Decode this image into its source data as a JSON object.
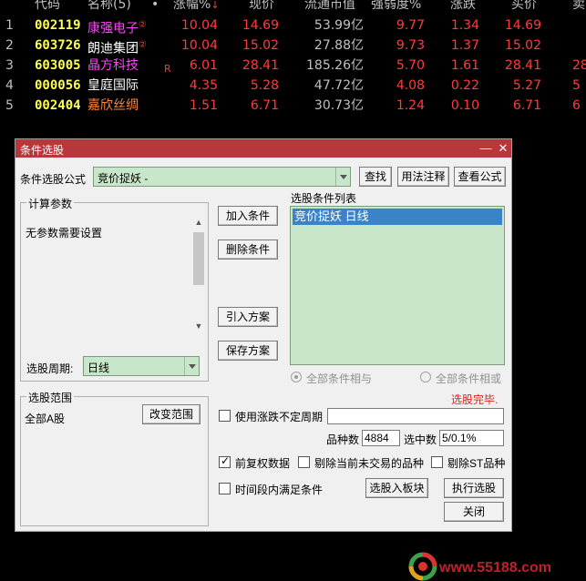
{
  "table": {
    "headers": [
      "代码",
      "名称(5)",
      "•",
      "涨幅%",
      "现价",
      "流通市值",
      "强弱度%",
      "涨跌",
      "买价",
      "卖"
    ],
    "rows": [
      {
        "idx": "1",
        "code": "002119",
        "name": "康强电子",
        "mark": "②",
        "name_color": "#ff44ff",
        "flag": "",
        "chg_pct": "10.04",
        "price": "14.69",
        "mcap": "53.99亿",
        "strength": "9.77",
        "chg": "1.34",
        "bid": "14.69",
        "ask": ""
      },
      {
        "idx": "2",
        "code": "603726",
        "name": "朗迪集团",
        "mark": "②",
        "name_color": "#ffffff",
        "flag": "",
        "chg_pct": "10.04",
        "price": "15.02",
        "mcap": "27.88亿",
        "strength": "9.73",
        "chg": "1.37",
        "bid": "15.02",
        "ask": ""
      },
      {
        "idx": "3",
        "code": "603005",
        "name": "晶方科技",
        "mark": "",
        "name_color": "#ff44ff",
        "flag": "R",
        "chg_pct": "6.01",
        "price": "28.41",
        "mcap": "185.26亿",
        "strength": "5.70",
        "chg": "1.61",
        "bid": "28.41",
        "ask": "28"
      },
      {
        "idx": "4",
        "code": "000056",
        "name": "皇庭国际",
        "mark": "",
        "name_color": "#ffffff",
        "flag": "",
        "chg_pct": "4.35",
        "price": "5.28",
        "mcap": "47.72亿",
        "strength": "4.08",
        "chg": "0.22",
        "bid": "5.27",
        "ask": "5"
      },
      {
        "idx": "5",
        "code": "002404",
        "name": "嘉欣丝绸",
        "mark": "",
        "name_color": "#ff8a3c",
        "flag": "",
        "chg_pct": "1.51",
        "price": "6.71",
        "mcap": "30.73亿",
        "strength": "1.24",
        "chg": "0.10",
        "bid": "6.71",
        "ask": "6"
      }
    ]
  },
  "dialog": {
    "title": "条件选股",
    "formula_label": "条件选股公式",
    "formula_value": "竞价捉妖    -",
    "find_button": "查找",
    "usage_button": "用法注释",
    "view_formula_button": "查看公式",
    "params_group": "计算参数",
    "params_text": "无参数需要设置",
    "add_condition": "加入条件",
    "delete_condition": "删除条件",
    "import_plan": "引入方案",
    "save_plan": "保存方案",
    "condition_list_label": "选股条件列表",
    "condition_items": [
      "竞价捉妖  日线"
    ],
    "period_label": "选股周期:",
    "period_value": "日线",
    "radio_and": "全部条件相与",
    "radio_or": "全部条件相或",
    "status": "选股完毕.",
    "range_group": "选股范围",
    "range_value": "全部A股",
    "change_range": "改变范围",
    "use_variable_period": "使用涨跌不定周期",
    "count_label": "品种数",
    "count_value": "4884",
    "selected_label": "选中数",
    "selected_value": "5/0.1%",
    "adjusted_data": "前复权数据",
    "exclude_untraded": "剔除当前未交易的品种",
    "exclude_st": "剔除ST品种",
    "time_range_condition": "时间段内满足条件",
    "select_to_block": "选股入板块",
    "execute": "执行选股",
    "close": "关闭"
  },
  "watermark": {
    "text": "www.55188.com"
  },
  "colors": {
    "titlebar": "#b8373c",
    "up": "#ff3c3c",
    "code": "#ffff55",
    "list_bg": "#c8e6c9",
    "selection": "#3b83c8"
  }
}
